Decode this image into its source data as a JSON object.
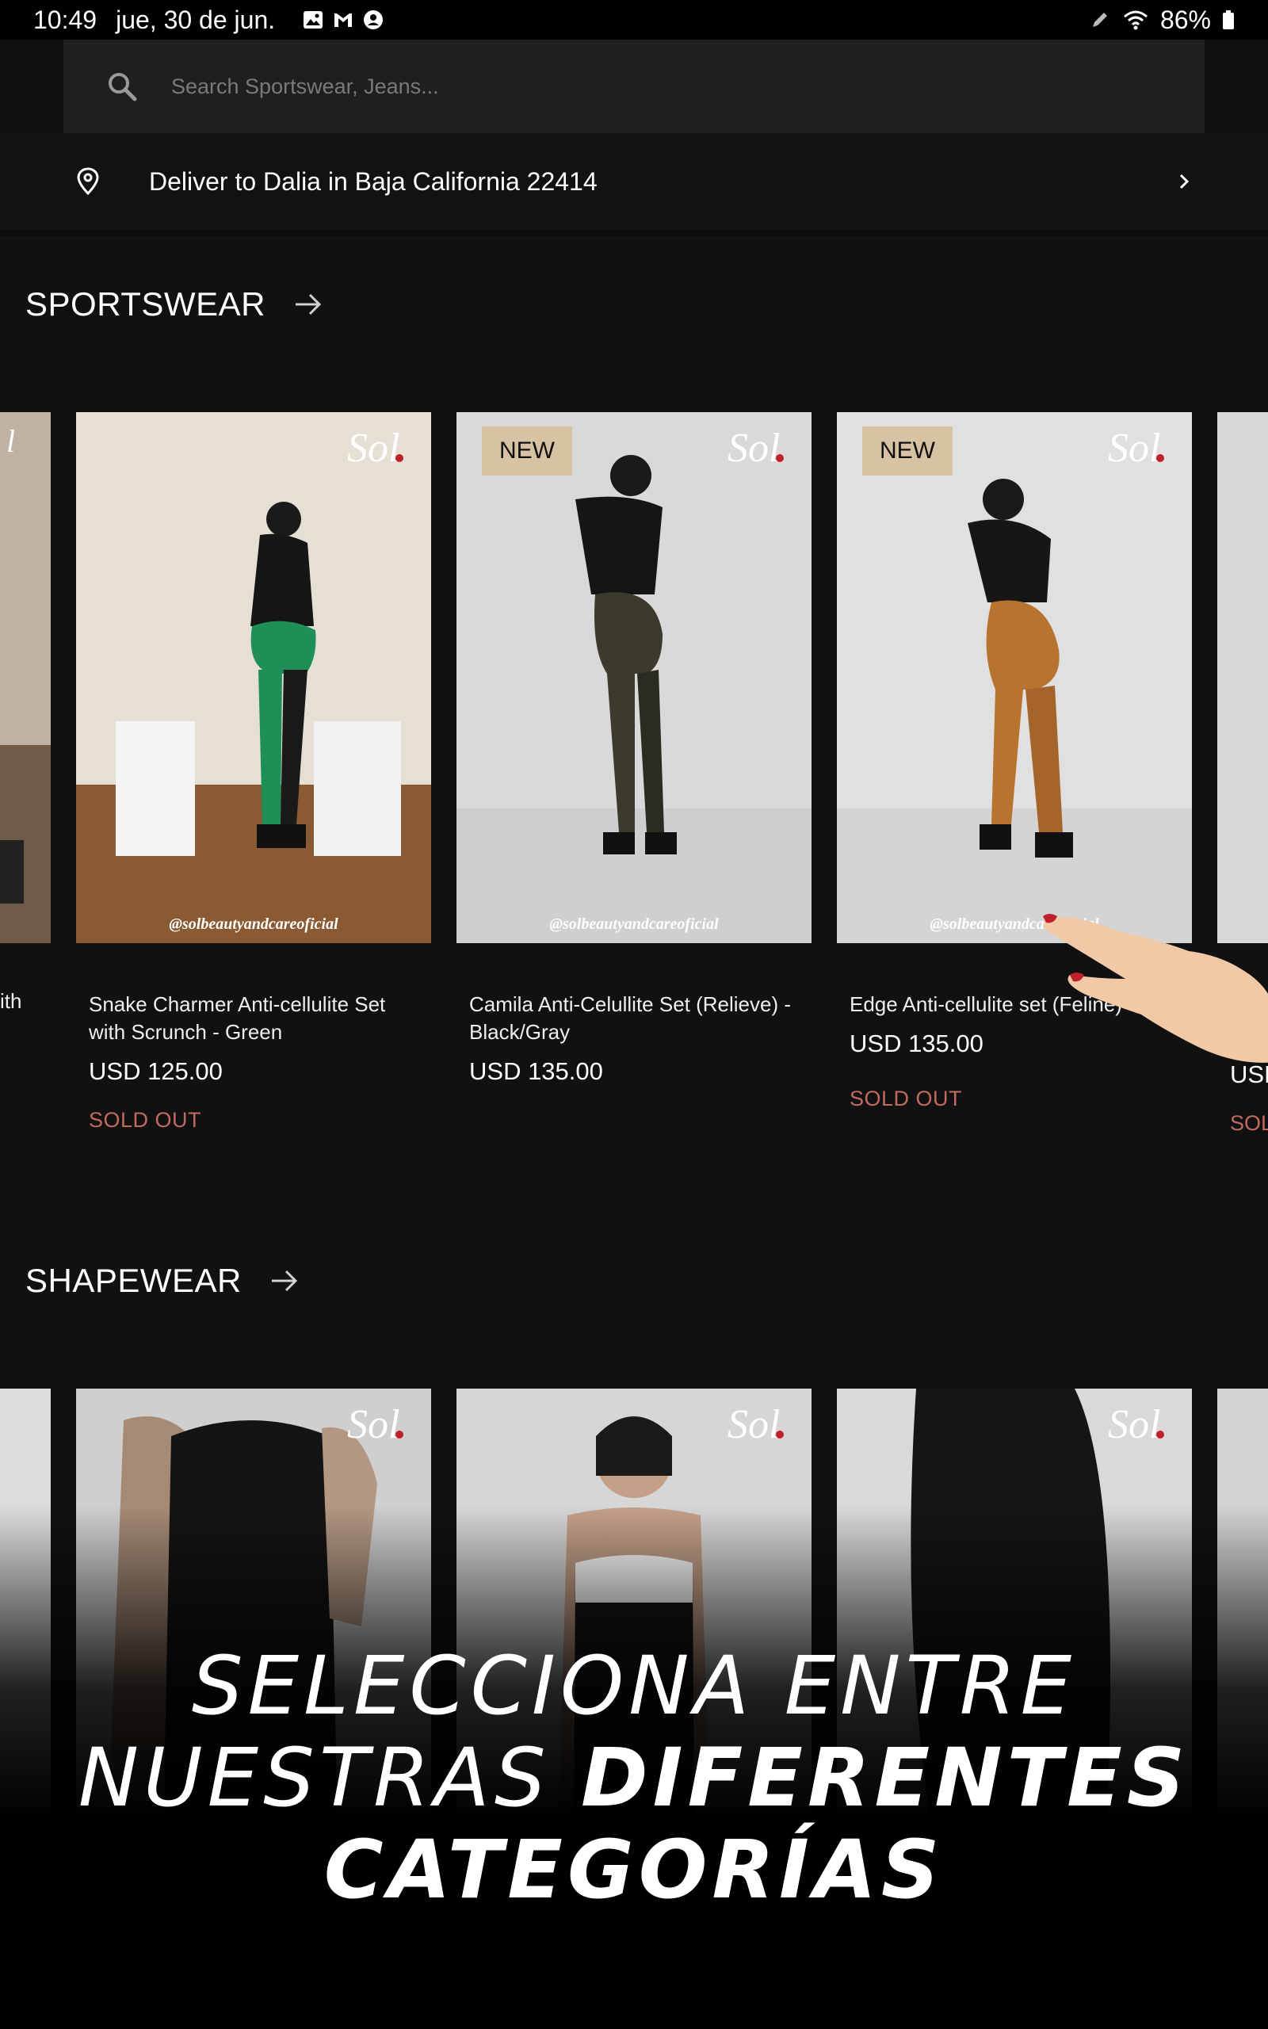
{
  "status_bar": {
    "time": "10:49",
    "date": "jue, 30 de jun.",
    "battery": "86%"
  },
  "search": {
    "placeholder": "Search Sportswear, Jeans..."
  },
  "delivery": {
    "text": "Deliver to Dalia in Baja California 22414"
  },
  "sections": [
    {
      "title": "SPORTSWEAR",
      "left_partial": {
        "title_fragment": "ith"
      },
      "products": [
        {
          "title": "Snake Charmer Anti-cellulite Set with Scrunch - Green",
          "price": "USD 125.00",
          "status": "SOLD OUT",
          "badge": "",
          "watermark": "@solbeautyandcareoficial",
          "legging_color": "#1f8f57"
        },
        {
          "title": "Camila Anti-Celullite Set (Relieve) - Black/Gray",
          "price": "USD 135.00",
          "status": "",
          "badge": "NEW",
          "watermark": "@solbeautyandcareoficial",
          "legging_color": "#3a3a2e"
        },
        {
          "title": "Edge Anti-cellulite set (Feline)",
          "price": "USD 135.00",
          "status": "SOLD OUT",
          "badge": "NEW",
          "watermark": "@solbeautyandcareoficial",
          "legging_color": "#b8742e"
        }
      ],
      "right_partial": {
        "price_fragment": "USD",
        "status_fragment": "SOL"
      }
    },
    {
      "title": "SHAPEWEAR"
    }
  ],
  "promo": {
    "line1": "SELECCIONA ENTRE",
    "line2_light": "NUESTRAS ",
    "line2_bold": "DIFERENTES",
    "line3_bold": "CATEGORÍAS"
  },
  "colors": {
    "background": "#111111",
    "badge": "#d7c3a3",
    "sold_out": "#c06a60"
  }
}
